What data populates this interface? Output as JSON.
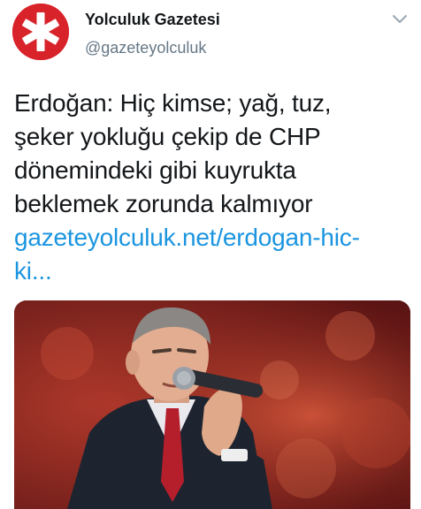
{
  "account": {
    "display_name": "Yolculuk Gazetesi",
    "handle": "@gazeteyolculuk",
    "avatar_icon": "asterisk-logo-icon",
    "avatar_color": "#d8232a"
  },
  "tweet": {
    "text_lines": [
      "Erdoğan: Hiç kimse; yağ, tuz,",
      "şeker yokluğu çekip de CHP",
      "dönemindeki gibi kuyrukta",
      "beklemek zorunda kalmıyor"
    ],
    "link_lines": [
      "gazeteyolculuk.net/erdogan-hic-",
      "ki..."
    ],
    "link_color": "#1b95e0"
  },
  "menu_icon": "chevron-down-icon",
  "media": {
    "icon": "photo-icon"
  }
}
